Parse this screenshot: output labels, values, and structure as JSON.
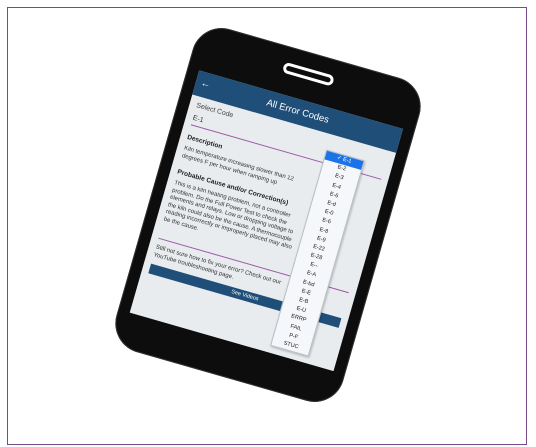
{
  "app": {
    "title": "All Error Codes",
    "back_icon": "arrow-left-icon"
  },
  "select": {
    "label": "Select Code",
    "value": "E-1",
    "options": [
      "E-1",
      "E-2",
      "E-3",
      "E-4",
      "E-6",
      "E-d",
      "E-0",
      "E-6",
      "E-8",
      "E-9",
      "E-22",
      "E-28",
      "E--",
      "E-A",
      "E-bd",
      "E-E",
      "E-B",
      "E-U",
      "ERRP",
      "FAIL",
      "P-F",
      "STUC"
    ]
  },
  "description": {
    "heading": "Description",
    "text": "Kiln temperature increasing slower than 12 degrees F per hour when ramping up"
  },
  "cause": {
    "heading": "Probable Cause and/or Correction(s)",
    "text": "This is a kiln heating problem, not a controller problem. Do the Full Power Test to check the elements and relays. Low or dropping voltage to the kiln could also be the cause. A thermocouple reading incorrectly or improperly placed may also be the cause."
  },
  "help": {
    "text": "Still not sure how to fix your error? Check out our YouTube troubleshooting page.",
    "button": "See Videos"
  }
}
